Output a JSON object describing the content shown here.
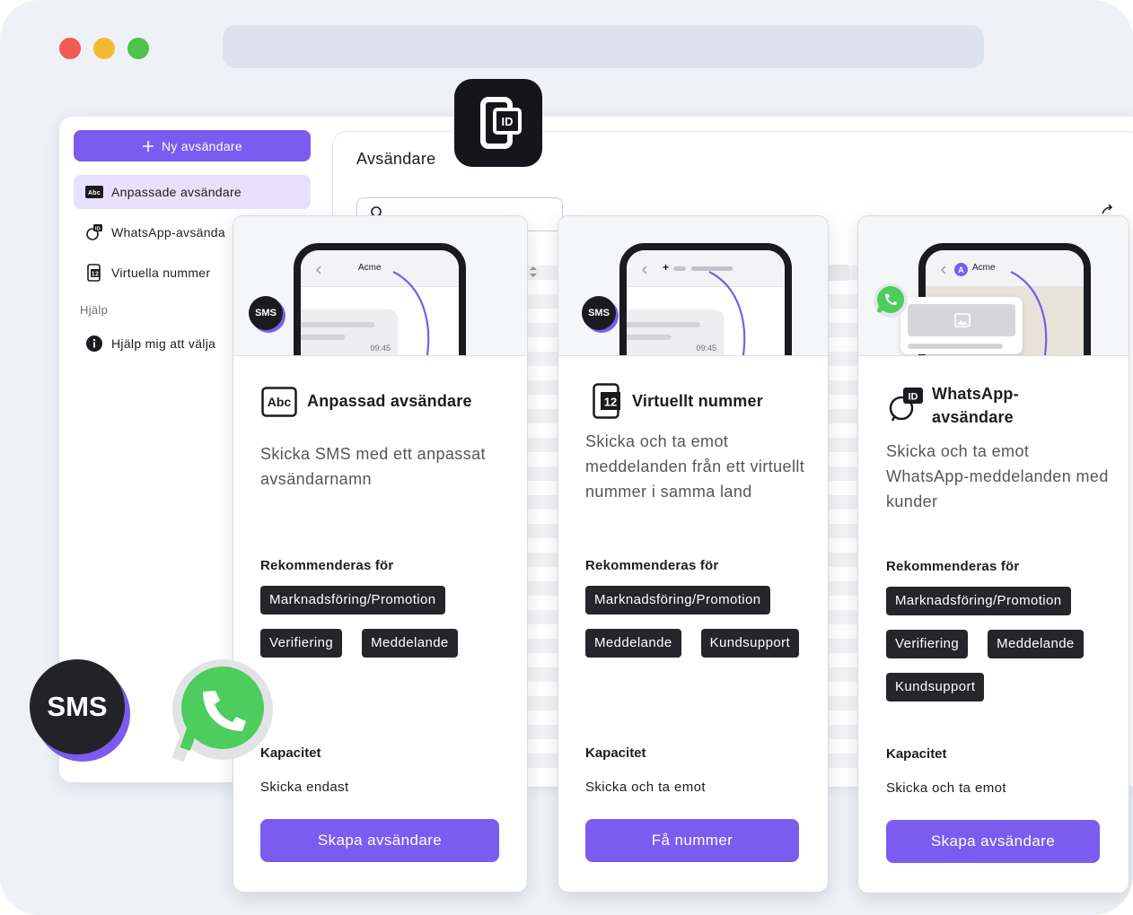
{
  "sidebar": {
    "new_button": "Ny avsändare",
    "items": [
      {
        "label": "Anpassade avsändare",
        "icon": "abc-icon",
        "active": true
      },
      {
        "label": "WhatsApp-avsända",
        "icon": "whatsapp-id-icon",
        "active": false
      },
      {
        "label": "Virtuella nummer",
        "icon": "number-12-icon",
        "active": false
      }
    ],
    "help_heading": "Hjälp",
    "help_item": "Hjälp mig att välja"
  },
  "panel": {
    "title": "Avsändare"
  },
  "badges": {
    "sms_small": "SMS",
    "sms_big": "SMS"
  },
  "cards": [
    {
      "preview": {
        "sender": "Acme",
        "time": "09:45",
        "badge": "SMS"
      },
      "icon_text": "Abc",
      "title": "Anpassad avsändare",
      "description": "Skicka SMS med ett anpassat avsändarnamn",
      "recommended_label": "Rekommenderas för",
      "tags": [
        "Marknadsföring/Promotion",
        "Verifiering",
        "Meddelande"
      ],
      "capacity_label": "Kapacitet",
      "capacity_value": "Skicka endast",
      "button": "Skapa avsändare"
    },
    {
      "preview": {
        "sender": "+",
        "time": "09:45",
        "badge": "SMS"
      },
      "icon_text": "12",
      "title": "Virtuellt nummer",
      "description": "Skicka och ta emot meddelanden från ett virtuellt nummer i samma land",
      "recommended_label": "Rekommenderas för",
      "tags": [
        "Marknadsföring/Promotion",
        "Meddelande",
        "Kundsupport"
      ],
      "capacity_label": "Kapacitet",
      "capacity_value": "Skicka och ta emot",
      "button": "Få nummer"
    },
    {
      "preview": {
        "sender": "Acme",
        "avatar": "A"
      },
      "icon_text": "ID",
      "title": "WhatsApp-avsändare",
      "description": "Skicka och ta emot WhatsApp-meddelanden med kunder",
      "recommended_label": "Rekommenderas för",
      "tags": [
        "Marknadsföring/Promotion",
        "Verifiering",
        "Meddelande",
        "Kundsupport"
      ],
      "capacity_label": "Kapacitet",
      "capacity_value": "Skicka och ta emot",
      "button": "Skapa avsändare"
    }
  ],
  "colors": {
    "accent": "#7b5cf0",
    "tag_bg": "#25252a",
    "whatsapp_green": "#4ccd5e",
    "close_dot": "#ef5a52",
    "minimize_dot": "#f4bb2f",
    "maximize_dot": "#4bc447"
  }
}
